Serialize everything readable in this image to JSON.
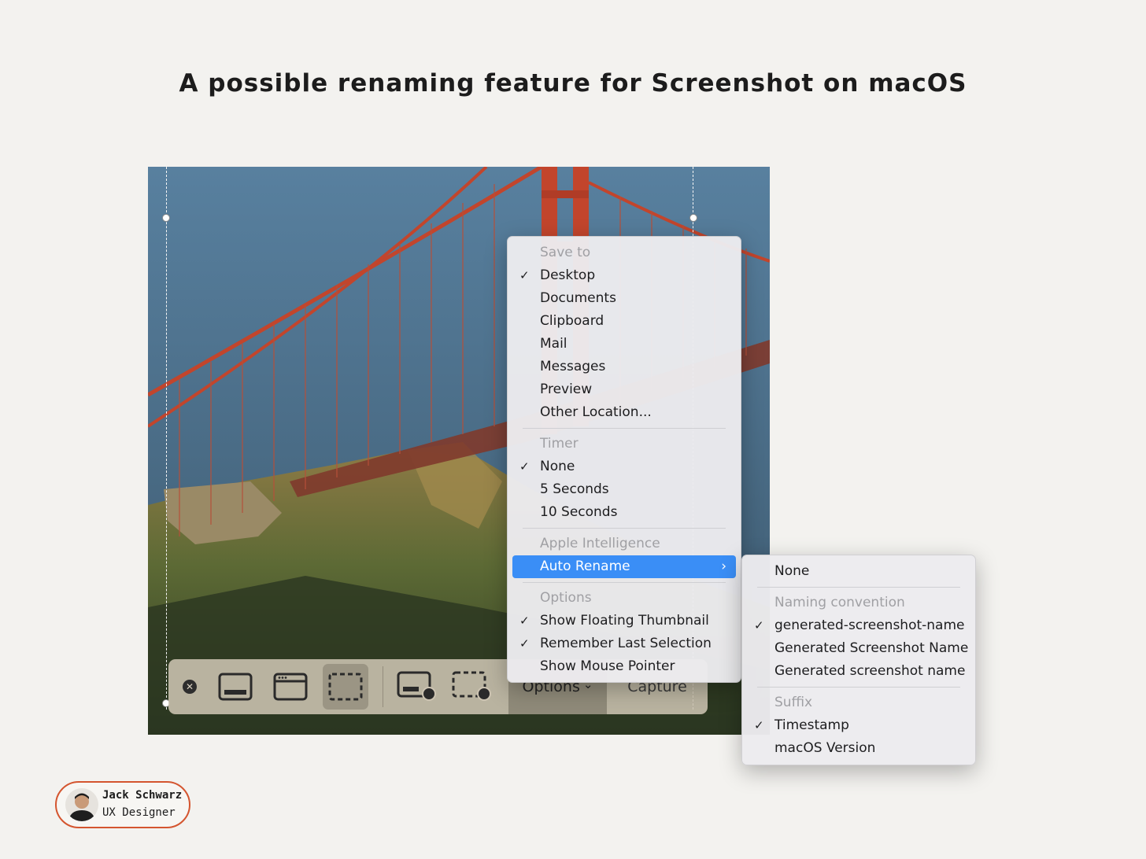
{
  "page": {
    "title": "A possible renaming feature for Screenshot on macOS"
  },
  "toolbar": {
    "close_icon": "close-icon",
    "buttons": [
      {
        "icon": "capture-entire-screen-icon"
      },
      {
        "icon": "capture-window-icon"
      },
      {
        "icon": "capture-selection-icon",
        "active": true
      },
      {
        "icon": "record-entire-screen-icon"
      },
      {
        "icon": "record-selection-icon"
      }
    ],
    "options_label": "Options",
    "options_chevron": "⌄",
    "capture_label": "Capture"
  },
  "main_menu": {
    "save_to": {
      "header": "Save to",
      "items": [
        {
          "label": "Desktop",
          "checked": true
        },
        {
          "label": "Documents"
        },
        {
          "label": "Clipboard"
        },
        {
          "label": "Mail"
        },
        {
          "label": "Messages"
        },
        {
          "label": "Preview"
        },
        {
          "label": "Other Location..."
        }
      ]
    },
    "timer": {
      "header": "Timer",
      "items": [
        {
          "label": "None",
          "checked": true
        },
        {
          "label": "5 Seconds"
        },
        {
          "label": "10 Seconds"
        }
      ]
    },
    "apple_intelligence": {
      "header": "Apple Intelligence",
      "items": [
        {
          "label": "Auto Rename",
          "highlighted": true,
          "submenu": true
        }
      ]
    },
    "options": {
      "header": "Options",
      "items": [
        {
          "label": "Show Floating Thumbnail",
          "checked": true
        },
        {
          "label": "Remember Last Selection",
          "checked": true
        },
        {
          "label": "Show Mouse Pointer"
        }
      ]
    },
    "check_glyph": "✓",
    "chevron_glyph": "›"
  },
  "sub_menu": {
    "none_label": "None",
    "naming": {
      "header": "Naming convention",
      "items": [
        {
          "label": "generated-screenshot-name",
          "checked": true
        },
        {
          "label": "Generated Screenshot Name"
        },
        {
          "label": "Generated screenshot name"
        }
      ]
    },
    "suffix": {
      "header": "Suffix",
      "items": [
        {
          "label": "Timestamp",
          "checked": true
        },
        {
          "label": "macOS Version"
        }
      ]
    }
  },
  "author": {
    "name": "Jack Schwarz",
    "role": "UX Designer"
  },
  "colors": {
    "accent": "#3a8ef6",
    "badge_border": "#d4552f",
    "bridge": "#c2452c"
  }
}
